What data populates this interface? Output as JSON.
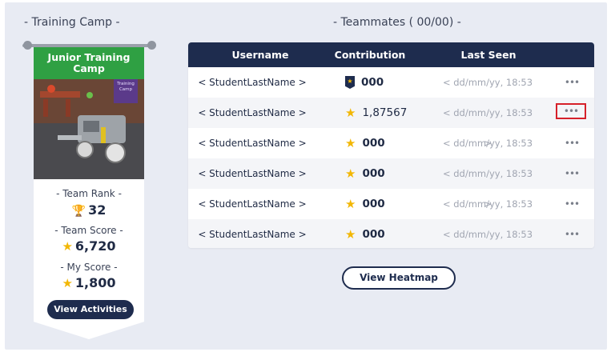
{
  "left_panel": {
    "section_title": "- Training Camp -",
    "banner_title": "Junior Training Camp",
    "image_tag": "Training Camp",
    "team_rank_label": "- Team Rank -",
    "team_rank_value": "32",
    "team_score_label": "- Team Score -",
    "team_score_value": "6,720",
    "my_score_label": "- My Score -",
    "my_score_value": "1,800",
    "view_activities_label": "View Activities"
  },
  "teammates": {
    "section_title": "- Teammates ( 00/00) -",
    "columns": [
      "Username",
      "Contribution",
      "Last Seen"
    ],
    "rows": [
      {
        "username": "< StudentLastName >",
        "contribution": "000",
        "icon": "rank-badge-icon",
        "last_seen": "< dd/mm/yy, 18:53 >",
        "more": "•••"
      },
      {
        "username": "< StudentLastName >",
        "contribution": "1,87567",
        "icon": "star-icon",
        "last_seen": "< dd/mm/yy, 18:53 >",
        "more": "•••"
      },
      {
        "username": "< StudentLastName >",
        "contribution": "000",
        "icon": "star-icon",
        "last_seen": "< dd/mm/yy, 18:53 >",
        "more": "•••"
      },
      {
        "username": "< StudentLastName >",
        "contribution": "000",
        "icon": "star-icon",
        "last_seen": "< dd/mm/yy, 18:53 >",
        "more": "•••"
      },
      {
        "username": "< StudentLastName >",
        "contribution": "000",
        "icon": "star-icon",
        "last_seen": "< dd/mm/yy, 18:53 >",
        "more": "•••"
      },
      {
        "username": "< StudentLastName >",
        "contribution": "000",
        "icon": "star-icon",
        "last_seen": "< dd/mm/yy, 18:53 >",
        "more": "•••"
      }
    ],
    "view_heatmap_label": "View Heatmap"
  },
  "colors": {
    "navy": "#1e2c4e",
    "green": "#2fa043",
    "gold": "#f2b705",
    "highlight_red": "#d6202a",
    "background": "#e8ebf3"
  }
}
